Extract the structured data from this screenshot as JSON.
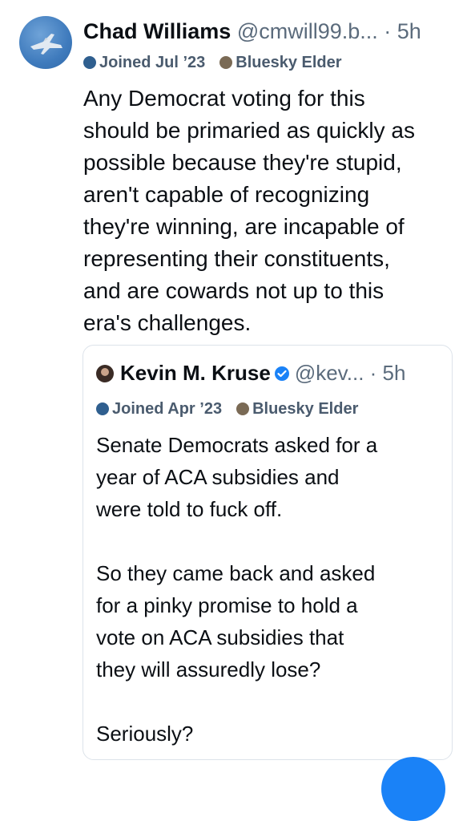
{
  "post": {
    "author_name": "Chad Williams",
    "handle": "@cmwill99.b...",
    "time": "· 5h",
    "joined": "Joined Jul ’23",
    "badge": "Bluesky Elder",
    "text": "Any Democrat voting for this\nshould be primaried as quickly as\npossible because they're stupid,\naren't capable of recognizing\nthey're winning, are incapable of\nrepresenting their constituents,\nand are cowards not up to this\nera's challenges."
  },
  "quoted_post": {
    "author_name": "Kevin M. Kruse",
    "handle": "@kev...",
    "time": "· 5h",
    "joined": "Joined Apr ’23",
    "badge": "Bluesky Elder",
    "text": "Senate Democrats asked for a\nyear of ACA subsidies and\nwere told to fuck off.\n\nSo they came back and asked\nfor a pinky promise to hold a\nvote on ACA subsidies that\nthey will assuredly lose?\n\nSeriously?"
  },
  "icons": {
    "avatar": "jet-avatar",
    "joined": "globe-icon",
    "badge": "elder-badge-icon",
    "verified": "verified-check-icon",
    "fab": "compose-button"
  },
  "colors": {
    "accent": "#1a82f7",
    "meta_text": "#4a5b6e",
    "handle_text": "#5b6b7c"
  }
}
